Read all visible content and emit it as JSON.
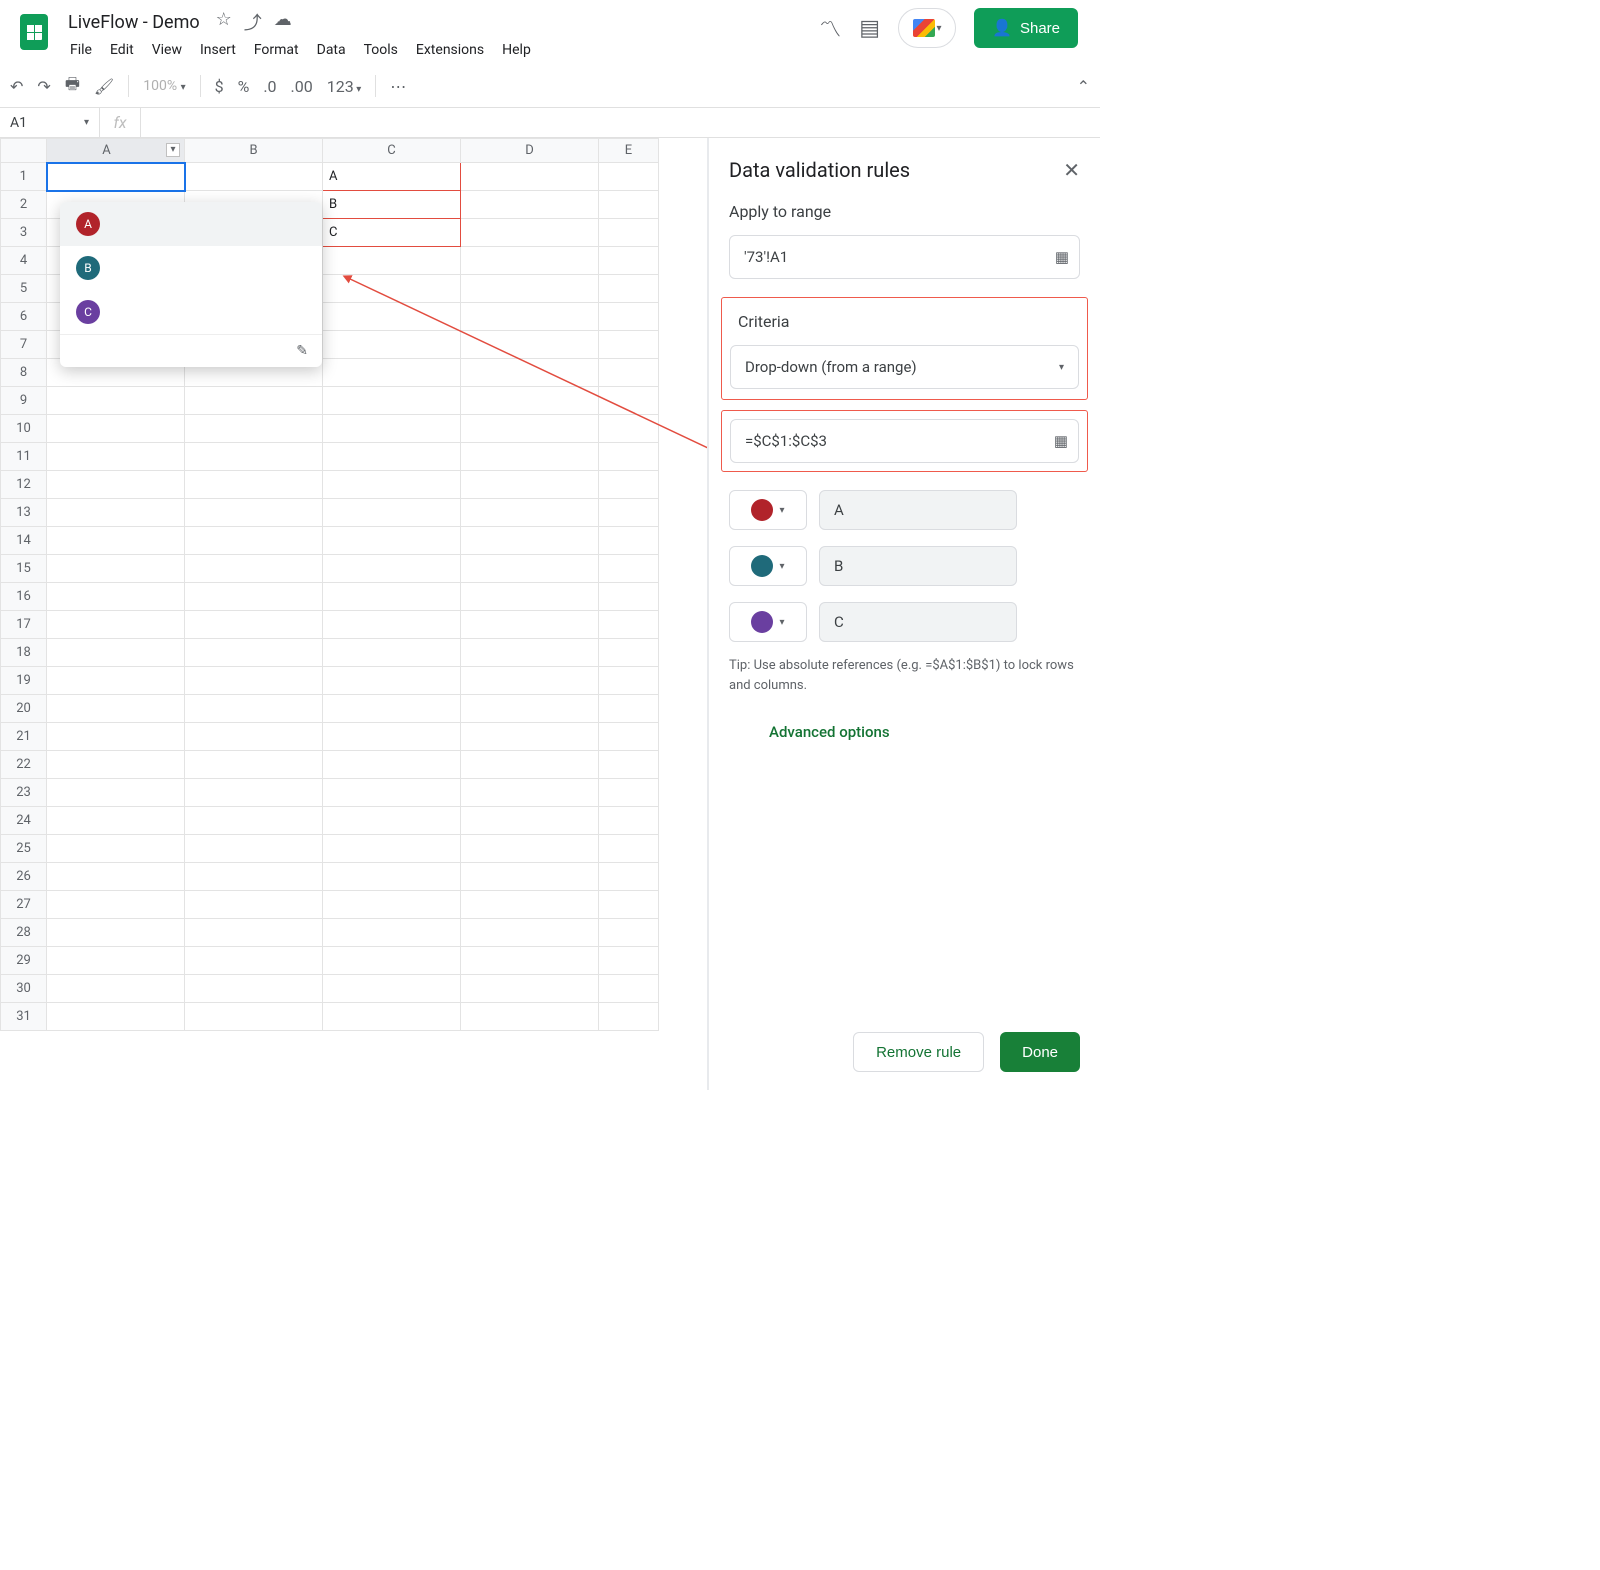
{
  "header": {
    "doc_title": "LiveFlow - Demo",
    "menus": [
      "File",
      "Edit",
      "View",
      "Insert",
      "Format",
      "Data",
      "Tools",
      "Extensions",
      "Help"
    ],
    "share_label": "Share"
  },
  "toolbar": {
    "zoom": "100%",
    "currency": "$",
    "percent": "%",
    "dec_dec": ".0",
    "inc_dec": ".00",
    "num_123": "123"
  },
  "fx": {
    "name_box": "A1",
    "fx_label": "fx",
    "formula": ""
  },
  "grid": {
    "cols": [
      "A",
      "B",
      "C",
      "D",
      "E"
    ],
    "rows": 31,
    "c_values": [
      "A",
      "B",
      "C"
    ]
  },
  "popover": {
    "items": [
      {
        "label": "A",
        "color": "#b1232a"
      },
      {
        "label": "B",
        "color": "#1f6a7a"
      },
      {
        "label": "C",
        "color": "#6a3fa0"
      }
    ]
  },
  "sidebar": {
    "title": "Data validation rules",
    "apply_label": "Apply to range",
    "range_value": "'73'!A1",
    "criteria_label": "Criteria",
    "criteria_value": "Drop-down (from a range)",
    "formula_value": "=$C$1:$C$3",
    "options": [
      {
        "color": "#b1232a",
        "value": "A"
      },
      {
        "color": "#1f6a7a",
        "value": "B"
      },
      {
        "color": "#6a3fa0",
        "value": "C"
      }
    ],
    "tip": "Tip: Use absolute references (e.g. =$A$1:$B$1) to lock rows and columns.",
    "advanced": "Advanced options",
    "remove": "Remove rule",
    "done": "Done"
  }
}
